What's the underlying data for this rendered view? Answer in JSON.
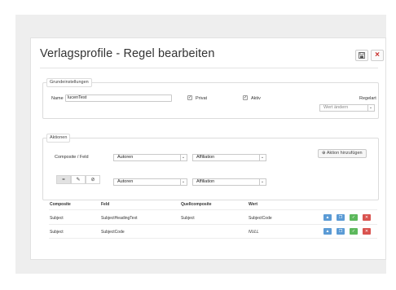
{
  "colors": {
    "accent_blue": "#5b9bd5",
    "accent_green": "#5cb85c",
    "accent_red": "#d9534f",
    "close_red": "#c9302c"
  },
  "header": {
    "title": "Verlagsprofile - Regel bearbeiten",
    "save_icon": "floppy-disk-icon",
    "close_icon": "close-icon",
    "close_glyph": "×"
  },
  "grund": {
    "legend": "Grundeinstellungen",
    "name_label": "Name",
    "name_value": "lucenTest",
    "privat_label": "Privat",
    "privat_checked": true,
    "aktiv_label": "Aktiv",
    "aktiv_checked": true,
    "regelart_label": "Regelart",
    "regelart_value": "Wert ändern"
  },
  "aktionen": {
    "legend": "Aktionen",
    "composite_label": "Composite / Feld",
    "select1_value": "Autoren",
    "select2_value": "Affiliation",
    "add_button": "Aktion hinzufügen",
    "add_icon": "plus-circle-icon",
    "seg": [
      {
        "name": "equals-toggle",
        "icon": "equals-icon",
        "glyph": "="
      },
      {
        "name": "edit-toggle",
        "icon": "pencil-icon",
        "glyph": "✎"
      },
      {
        "name": "null-toggle",
        "icon": "empty-set-icon",
        "glyph": "⊘"
      }
    ],
    "select3_value": "Autoren",
    "select4_value": "Affiliation"
  },
  "table": {
    "headers": [
      "Composite",
      "Feld",
      "Quellcomposite",
      "Wert"
    ],
    "rows": [
      {
        "composite": "Subject",
        "feld": "SubjectHeadingText",
        "quell": "Subject",
        "wert": "SubjectCode"
      },
      {
        "composite": "Subject",
        "feld": "SubjectCode",
        "quell": "",
        "wert": "NULL"
      }
    ],
    "row_actions": [
      "move-up-icon",
      "copy-icon",
      "check-icon",
      "delete-icon"
    ]
  }
}
